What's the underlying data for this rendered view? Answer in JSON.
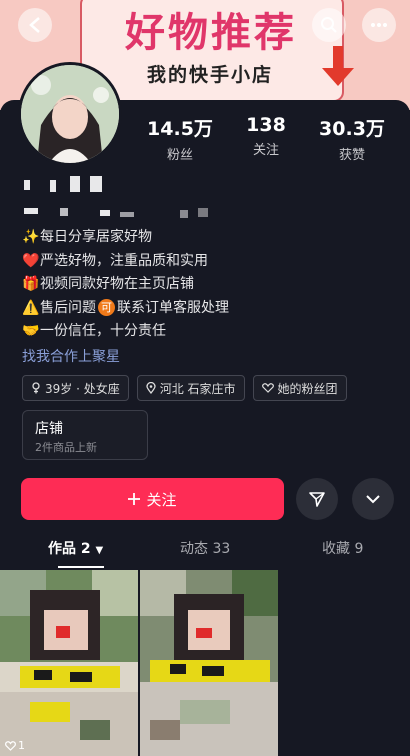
{
  "banner": {
    "title": "好物推荐",
    "subtitle": "我的快手小店"
  },
  "header": {
    "back_icon": "chevron-left-icon",
    "search_icon": "search-icon",
    "more_icon": "more-icon"
  },
  "stats": [
    {
      "value": "14.5万",
      "label": "粉丝"
    },
    {
      "value": "138",
      "label": "关注"
    },
    {
      "value": "30.3万",
      "label": "获赞"
    }
  ],
  "bio": [
    {
      "emoji": "✨",
      "text": "每日分享居家好物"
    },
    {
      "emoji": "❤️",
      "text": "严选好物，注重品质和实用"
    },
    {
      "emoji": "🎁",
      "text": "视频同款好物在主页店铺"
    },
    {
      "emoji": "⚠️",
      "text": "售后问题",
      "badge": "可",
      "text2": "联系订单客服处理"
    },
    {
      "emoji": "🤝",
      "text": "一份信任，十分责任"
    }
  ],
  "link": "找我合作上聚星",
  "tags": [
    {
      "icon": "gender-female-icon",
      "text": "39岁 · 处女座"
    },
    {
      "icon": "location-icon",
      "text": "河北 石家庄市"
    },
    {
      "icon": "fan-group-icon",
      "text": "她的粉丝团"
    }
  ],
  "shop": {
    "title": "店铺",
    "subtitle": "2件商品上新"
  },
  "actions": {
    "follow": "关注"
  },
  "tabs": [
    {
      "label": "作品 2"
    },
    {
      "label": "动态 33"
    },
    {
      "label": "收藏 9"
    }
  ],
  "posts": [
    {
      "likes": "1"
    },
    {
      "likes": ""
    }
  ],
  "colors": {
    "accent": "#fe2c55",
    "bg": "#161823",
    "link": "#8a9fd8"
  }
}
